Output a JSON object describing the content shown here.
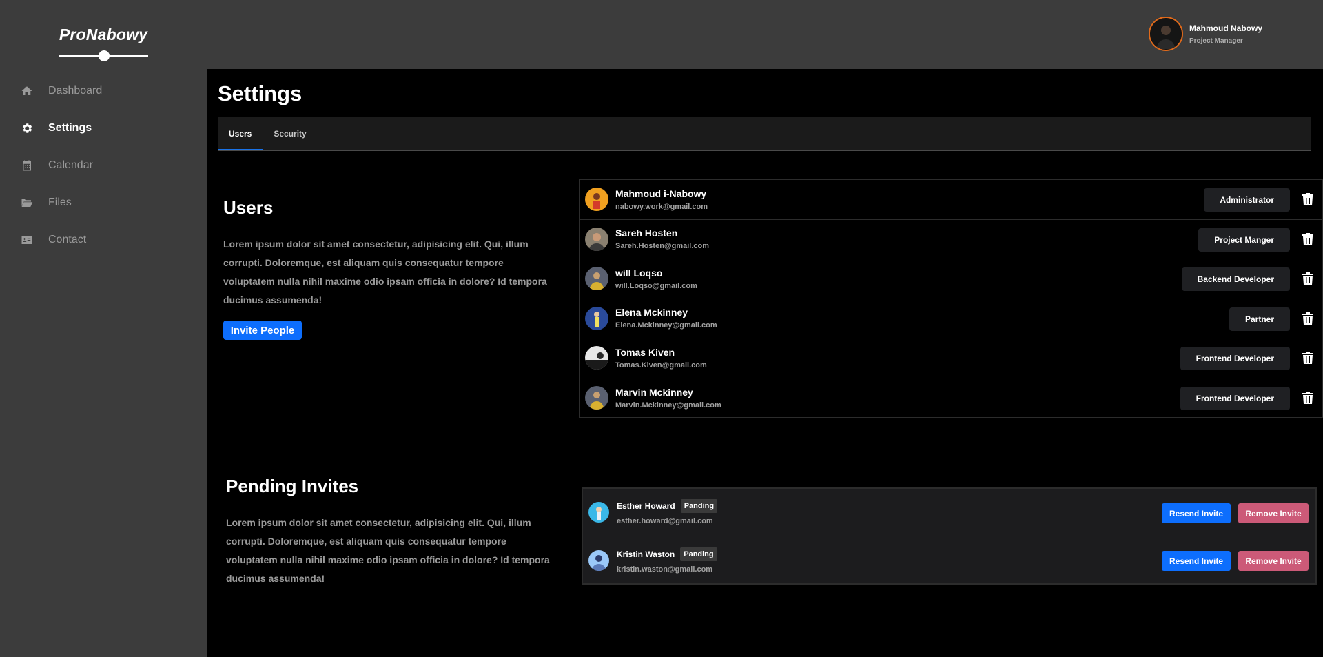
{
  "app": {
    "logo": "ProNabowy"
  },
  "sidebar": {
    "items": [
      {
        "label": "Dashboard",
        "icon": "home-icon",
        "active": false
      },
      {
        "label": "Settings",
        "icon": "gear-icon",
        "active": true
      },
      {
        "label": "Calendar",
        "icon": "calendar-icon",
        "active": false
      },
      {
        "label": "Files",
        "icon": "folder-icon",
        "active": false
      },
      {
        "label": "Contact",
        "icon": "contact-card-icon",
        "active": false
      }
    ]
  },
  "header": {
    "user_name": "Mahmoud Nabowy",
    "user_role": "Project Manager",
    "avatar_border_color": "#e06a1b"
  },
  "page": {
    "title": "Settings",
    "tabs": [
      {
        "label": "Users",
        "active": true
      },
      {
        "label": "Security",
        "active": false
      }
    ]
  },
  "users_section": {
    "title": "Users",
    "description": "Lorem ipsum dolor sit amet consectetur, adipisicing elit. Qui, illum corrupti. Doloremque, est aliquam quis consequatur tempore voluptatem nulla nihil maxime odio ipsam officia in dolore? Id tempora ducimus assumenda!",
    "invite_label": "Invite People",
    "users": [
      {
        "name": "Mahmoud i-Nabowy",
        "email": "nabowy.work@gmail.com",
        "role": "Administrator"
      },
      {
        "name": "Sareh Hosten",
        "email": "Sareh.Hosten@gmail.com",
        "role": "Project Manger"
      },
      {
        "name": "will Loqso",
        "email": "will.Loqso@gmail.com",
        "role": "Backend Developer"
      },
      {
        "name": "Elena Mckinney",
        "email": "Elena.Mckinney@gmail.com",
        "role": "Partner"
      },
      {
        "name": "Tomas Kiven",
        "email": "Tomas.Kiven@gmail.com",
        "role": "Frontend Developer"
      },
      {
        "name": "Marvin Mckinney",
        "email": "Marvin.Mckinney@gmail.com",
        "role": "Frontend Developer"
      }
    ]
  },
  "pending_section": {
    "title": "Pending Invites",
    "description": "Lorem ipsum dolor sit amet consectetur, adipisicing elit. Qui, illum corrupti. Doloremque, est aliquam quis consequatur tempore voluptatem nulla nihil maxime odio ipsam officia in dolore? Id tempora ducimus assumenda!",
    "invites": [
      {
        "name": "Esther Howard",
        "status": "Panding",
        "email": "esther.howard@gmail.com",
        "resend_label": "Resend Invite",
        "remove_label": "Remove Invite"
      },
      {
        "name": "Kristin Waston",
        "status": "Panding",
        "email": "kristin.waston@gmail.com",
        "resend_label": "Resend Invite",
        "remove_label": "Remove Invite"
      }
    ]
  },
  "colors": {
    "sidebar_bg": "#3c3c3c",
    "primary": "#0d6efd",
    "danger": "#cc5a78",
    "role_button_bg": "#1f2023"
  }
}
